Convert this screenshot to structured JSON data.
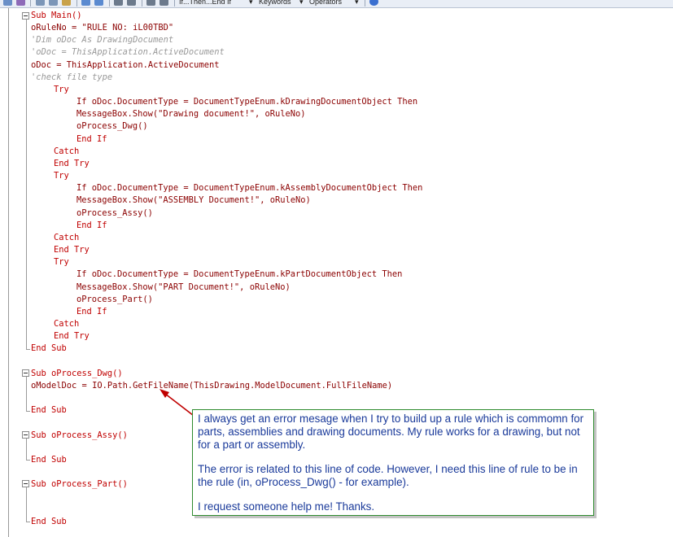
{
  "toolbar": {
    "snippets": "If...Then...End If",
    "keywords": "Keywords",
    "operators": "Operators"
  },
  "code": {
    "main_lines": [
      "Sub Main()",
      "oRuleNo = \"RULE NO: iL00TBD\"",
      "'Dim oDoc As DrawingDocument",
      "'oDoc = ThisApplication.ActiveDocument",
      "oDoc = ThisApplication.ActiveDocument",
      "'check file type",
      "Try",
      "If oDoc.DocumentType = DocumentTypeEnum.kDrawingDocumentObject Then",
      "MessageBox.Show(\"Drawing document!\", oRuleNo)",
      "oProcess_Dwg()",
      "End If",
      "Catch",
      "End Try",
      "Try",
      "If oDoc.DocumentType = DocumentTypeEnum.kAssemblyDocumentObject Then",
      "MessageBox.Show(\"ASSEMBLY Document!\", oRuleNo)",
      "oProcess_Assy()",
      "End If",
      "Catch",
      "End Try",
      "Try",
      "If oDoc.DocumentType = DocumentTypeEnum.kPartDocumentObject Then",
      "MessageBox.Show(\"PART Document!\", oRuleNo)",
      "oProcess_Part()",
      "End If",
      "Catch",
      "End Try",
      "End Sub"
    ],
    "dwg_lines": [
      "Sub oProcess_Dwg()",
      "oModelDoc = IO.Path.GetFileName(ThisDrawing.ModelDocument.FullFileName)",
      "End Sub"
    ],
    "assy_lines": [
      "Sub oProcess_Assy()",
      "End Sub"
    ],
    "part_lines": [
      "Sub oProcess_Part()",
      "End Sub"
    ]
  },
  "callout": {
    "paragraphs": [
      "I always get an error mesage when I try to build up a rule which is commomn for parts, assemblies and drawing documents. My rule works for a drawing, but not for a part or assembly.",
      "The error is related to this line of code. However, I need this line of rule to be in the rule (in, oProcess_Dwg() - for example).",
      "I request someone help me! Thanks."
    ]
  },
  "colors": {
    "keyword": "#c00000",
    "identifier": "#8b0000",
    "string": "#1f5fbf",
    "comment": "#999999",
    "member": "#8a1f8a",
    "callout_border": "#2e8b2e",
    "callout_text": "#1a3a9a",
    "arrow": "#c00000"
  }
}
